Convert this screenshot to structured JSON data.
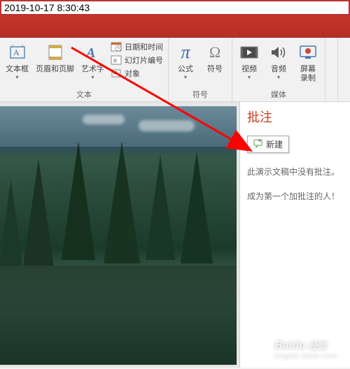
{
  "timestamp": "2019-10-17 8:30:43",
  "ribbon": {
    "groups": {
      "text": {
        "label": "文本",
        "textbox": "文本框",
        "headerFooter": "页眉和页脚",
        "wordart": "艺术字",
        "datetime": "日期和时间",
        "slideNumber": "幻灯片编号",
        "object": "对象"
      },
      "symbols": {
        "label": "符号",
        "equation": "公式",
        "symbol": "符号"
      },
      "media": {
        "label": "媒体",
        "video": "视频",
        "audio": "音频",
        "screenRec": "屏幕\n录制"
      }
    }
  },
  "comments": {
    "title": "批注",
    "newBtn": "新建",
    "emptyLine1": "此演示文稿中没有批注。",
    "emptyLine2": "成为第一个加批注的人！"
  },
  "watermark": {
    "brand": "Baidu",
    "sub": "jingyan.baidu.com"
  },
  "icons": {
    "pi": "π",
    "omega": "Ω"
  },
  "colors": {
    "accent": "#c43e1c",
    "arrow": "#ff0000"
  }
}
